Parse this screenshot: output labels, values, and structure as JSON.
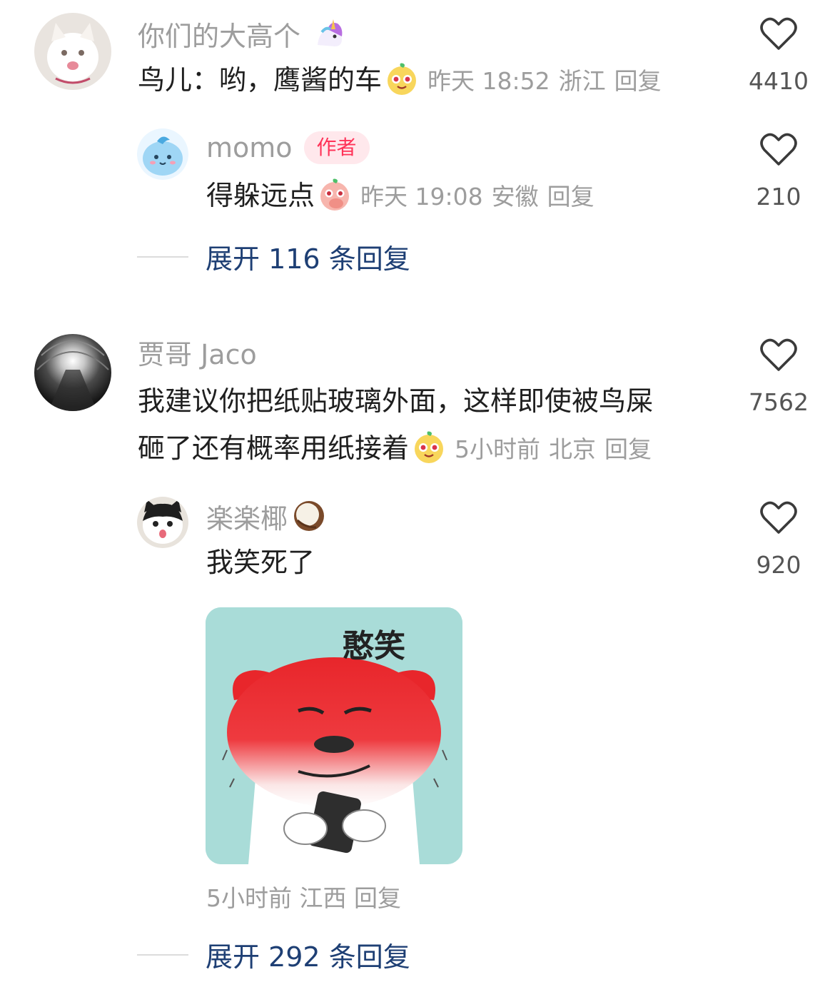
{
  "comments": [
    {
      "user": "你们的大高个",
      "user_emoji": "unicorn-icon",
      "text": "鸟儿：哟，鹰酱的车",
      "text_emoji": "smirk-face-icon",
      "time": "昨天 18:52",
      "location": "浙江",
      "reply_label": "回复",
      "likes": "4410",
      "replies": [
        {
          "user": "momo",
          "badge": "作者",
          "text": "得躲远点",
          "text_emoji": "covering-mouth-face-icon",
          "time": "昨天 19:08",
          "location": "安徽",
          "reply_label": "回复",
          "likes": "210"
        }
      ],
      "expand_label": "展开 116 条回复"
    },
    {
      "user": "贾哥 Jaco",
      "text_line1": "我建议你把纸贴玻璃外面，这样即使被鸟屎",
      "text_line2": "砸了还有概率用纸接着",
      "text_emoji": "smirk-face-icon",
      "time": "5小时前",
      "location": "北京",
      "reply_label": "回复",
      "likes": "7562",
      "replies": [
        {
          "user": "楽楽椰",
          "user_emoji": "coconut-icon",
          "text": "我笑死了",
          "sticker_caption": "憨笑",
          "time": "5小时前",
          "location": "江西",
          "reply_label": "回复",
          "likes": "920"
        }
      ],
      "expand_label": "展开 292 条回复"
    }
  ],
  "colors": {
    "meta": "#9d9d9d",
    "link": "#1e3f74",
    "author_badge_text": "#ff3358",
    "author_badge_bg": "#ffe8ec",
    "sticker_bg": "#a9dcd8"
  }
}
